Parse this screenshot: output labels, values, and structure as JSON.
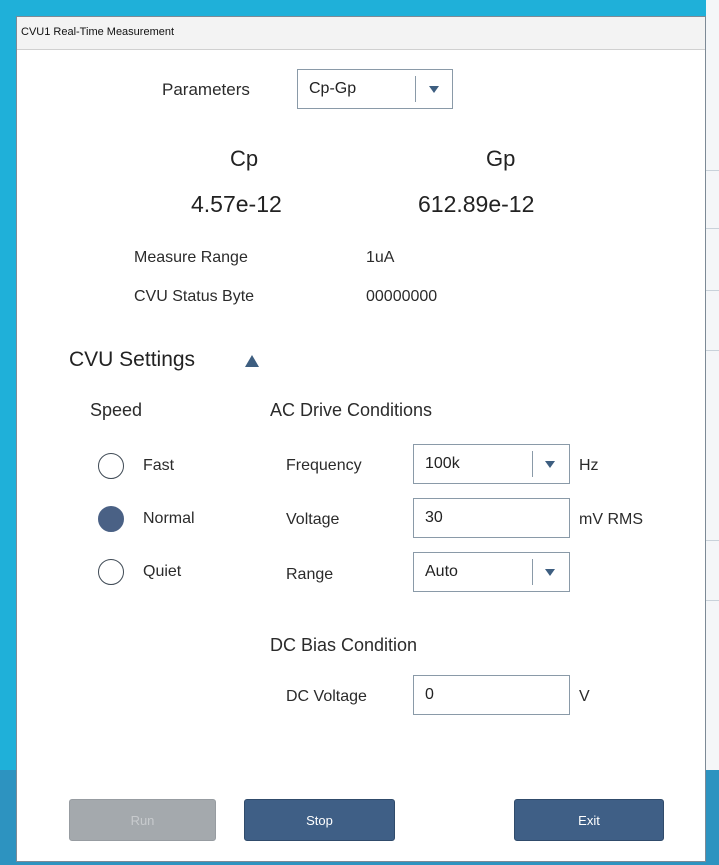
{
  "window": {
    "title": "CVU1 Real-Time Measurement"
  },
  "parameters": {
    "label": "Parameters",
    "selected": "Cp-Gp"
  },
  "readings": [
    {
      "name": "Cp",
      "value": "4.57e-12"
    },
    {
      "name": "Gp",
      "value": "612.89e-12"
    }
  ],
  "status": {
    "measure_range_label": "Measure Range",
    "measure_range_value": "1uA",
    "status_byte_label": "CVU Status Byte",
    "status_byte_value": "00000000"
  },
  "settings": {
    "title": "CVU Settings",
    "toggle_icon": "triangle-up-icon"
  },
  "speed": {
    "title": "Speed",
    "options": [
      {
        "label": "Fast",
        "checked": false
      },
      {
        "label": "Normal",
        "checked": true
      },
      {
        "label": "Quiet",
        "checked": false
      }
    ]
  },
  "ac_drive": {
    "title": "AC Drive Conditions",
    "frequency": {
      "label": "Frequency",
      "value": "100k",
      "unit": "Hz"
    },
    "voltage": {
      "label": "Voltage",
      "value": "30",
      "unit": "mV RMS"
    },
    "range": {
      "label": "Range",
      "value": "Auto"
    }
  },
  "dc_bias": {
    "title": "DC Bias Condition",
    "voltage": {
      "label": "DC Voltage",
      "value": "0",
      "unit": "V"
    }
  },
  "buttons": {
    "run": "Run",
    "stop": "Stop",
    "exit": "Exit"
  },
  "colors": {
    "background": "#1fb0d9",
    "accent": "#3f5f86",
    "disabled": "#a4a9ad"
  }
}
